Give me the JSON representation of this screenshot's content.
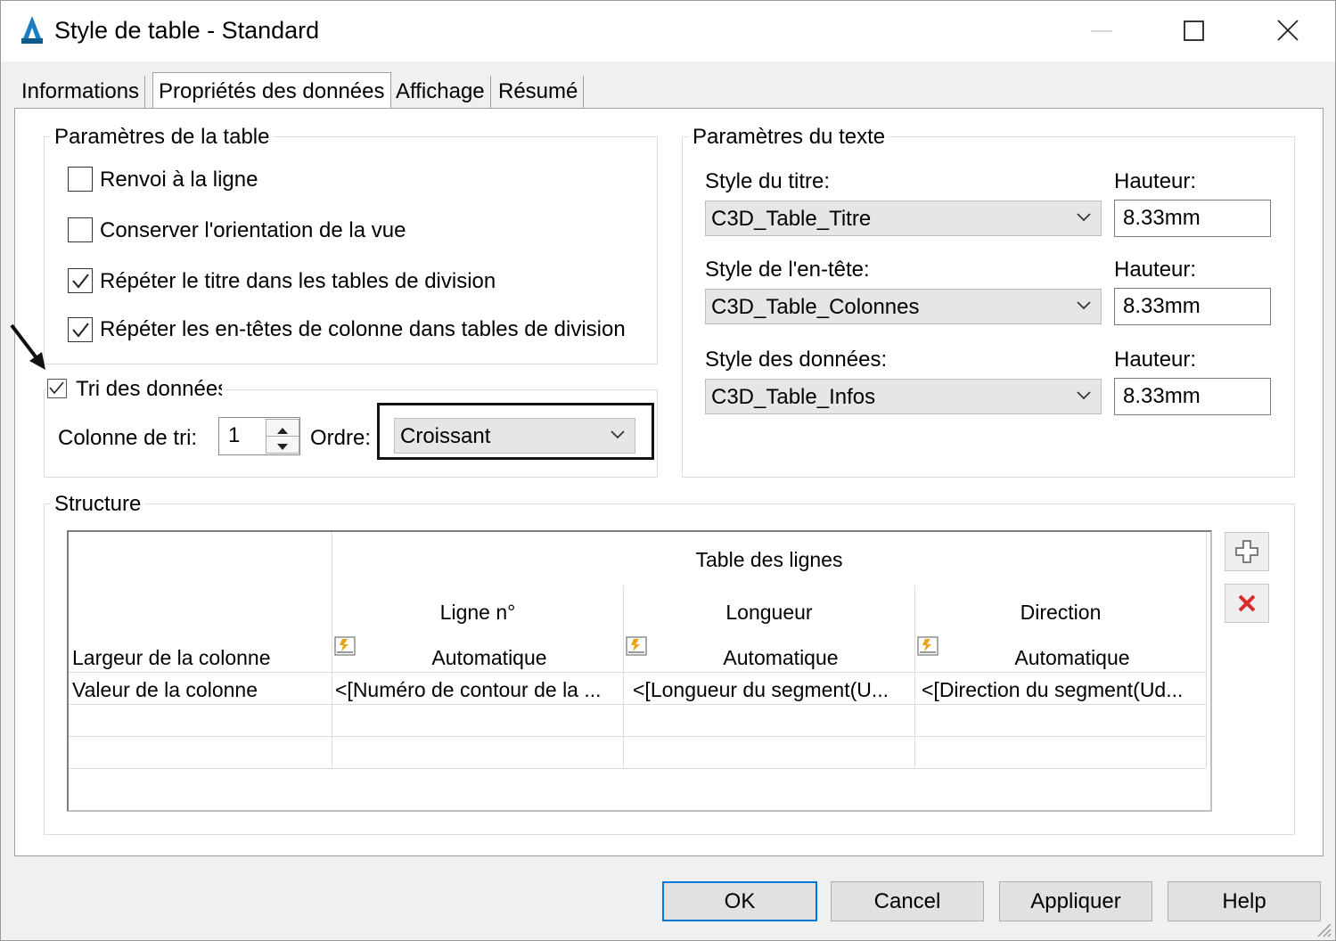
{
  "window": {
    "title": "Style de table - Standard"
  },
  "tabs": [
    {
      "label": "Informations"
    },
    {
      "label": "Propriétés des données"
    },
    {
      "label": "Affichage"
    },
    {
      "label": "Résumé"
    }
  ],
  "table_params": {
    "group_label": "Paramètres de la table",
    "options": [
      {
        "label": "Renvoi à la ligne",
        "checked": false
      },
      {
        "label": "Conserver l'orientation de la vue",
        "checked": false
      },
      {
        "label": "Répéter le titre dans les tables de division",
        "checked": true
      },
      {
        "label": "Répéter les en-têtes de colonne dans tables de division",
        "checked": true
      }
    ]
  },
  "sort": {
    "label": "Tri des données",
    "checked": true,
    "column_label": "Colonne de tri:",
    "column_value": "1",
    "order_label": "Ordre:",
    "order_value": "Croissant"
  },
  "text_params": {
    "group_label": "Paramètres du texte",
    "rows": [
      {
        "style_label": "Style du titre:",
        "style_value": "C3D_Table_Titre",
        "height_label": "Hauteur:",
        "height_value": "8.33mm"
      },
      {
        "style_label": "Style de l'en-tête:",
        "style_value": "C3D_Table_Colonnes",
        "height_label": "Hauteur:",
        "height_value": "8.33mm"
      },
      {
        "style_label": "Style des données:",
        "style_value": "C3D_Table_Infos",
        "height_label": "Hauteur:",
        "height_value": "8.33mm"
      }
    ]
  },
  "structure": {
    "group_label": "Structure",
    "table_title": "Table des lignes",
    "row_headers": [
      "Largeur de la colonne",
      "Valeur de la colonne"
    ],
    "columns": [
      {
        "header": "Ligne n°",
        "width": "Automatique",
        "value": "<[Numéro de contour de la ..."
      },
      {
        "header": "Longueur",
        "width": "Automatique",
        "value": "<[Longueur du segment(U..."
      },
      {
        "header": "Direction",
        "width": "Automatique",
        "value": "<[Direction du segment(Ud..."
      }
    ]
  },
  "buttons": {
    "ok": "OK",
    "cancel": "Cancel",
    "apply": "Appliquer",
    "help": "Help"
  },
  "colors": {
    "accent": "#0078d7",
    "delete": "#d92b2b"
  }
}
